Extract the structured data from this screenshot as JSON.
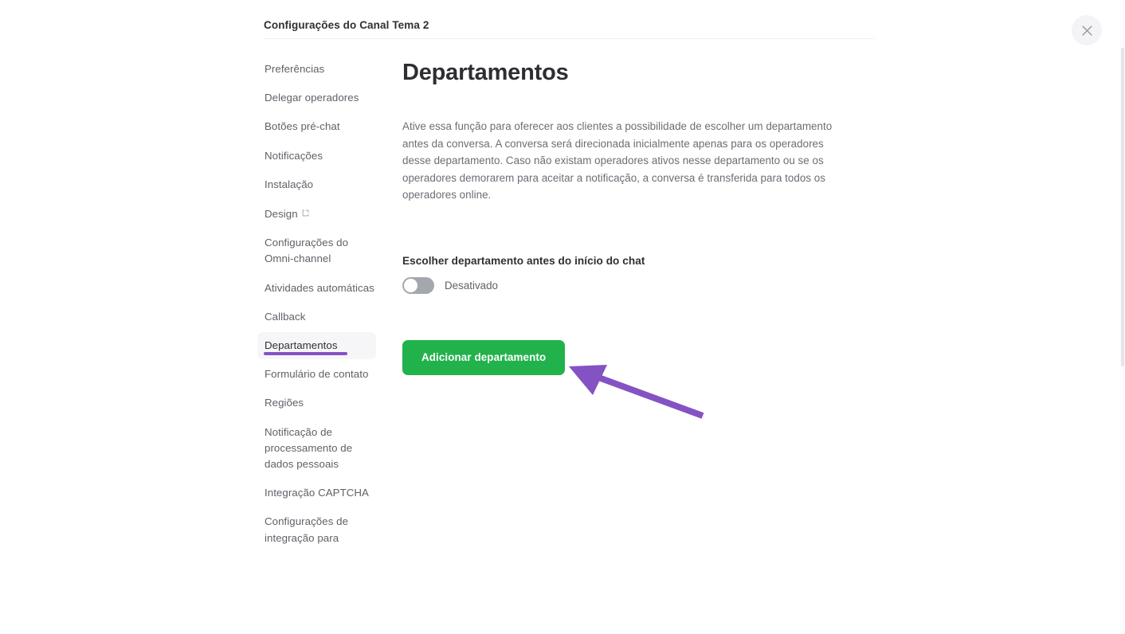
{
  "header": {
    "title": "Configurações do Canal Tema 2",
    "close_icon": "close-icon"
  },
  "sidebar": {
    "items": [
      {
        "label": "Preferências",
        "active": false,
        "external": false
      },
      {
        "label": "Delegar operadores",
        "active": false,
        "external": false
      },
      {
        "label": "Botões pré-chat",
        "active": false,
        "external": false
      },
      {
        "label": "Notificações",
        "active": false,
        "external": false
      },
      {
        "label": "Instalação",
        "active": false,
        "external": false
      },
      {
        "label": "Design",
        "active": false,
        "external": true
      },
      {
        "label": "Configurações do Omni-channel",
        "active": false,
        "external": false
      },
      {
        "label": "Atividades automáticas",
        "active": false,
        "external": false
      },
      {
        "label": "Callback",
        "active": false,
        "external": false
      },
      {
        "label": "Departamentos",
        "active": true,
        "external": false
      },
      {
        "label": "Formulário de contato",
        "active": false,
        "external": false
      },
      {
        "label": "Regiões",
        "active": false,
        "external": false
      },
      {
        "label": "Notificação de processamento de dados pessoais",
        "active": false,
        "external": false
      },
      {
        "label": "Integração CAPTCHA",
        "active": false,
        "external": false
      },
      {
        "label": "Configurações de integração para",
        "active": false,
        "external": false
      }
    ]
  },
  "main": {
    "title": "Departamentos",
    "description": "Ative essa função para oferecer aos clientes a possibilidade de escolher um departamento antes da conversa. A conversa será direcionada inicialmente apenas para os operadores desse departamento. Caso não existam operadores ativos nesse departamento ou se os operadores demorarem para aceitar a notificação, a conversa é transferida para todos os operadores online.",
    "toggle_section_label": "Escolher departamento antes do início do chat",
    "toggle_state_label": "Desativado",
    "toggle_enabled": false,
    "add_department_button": "Adicionar departamento"
  },
  "annotation": {
    "arrow_color": "#8552c4",
    "underline_color": "#8552c4"
  },
  "colors": {
    "accent_green": "#22b24c",
    "annotation_purple": "#8552c4",
    "active_item_bg": "#f6f6f8",
    "text_primary": "#2f3033",
    "text_secondary": "#6a6e74"
  }
}
